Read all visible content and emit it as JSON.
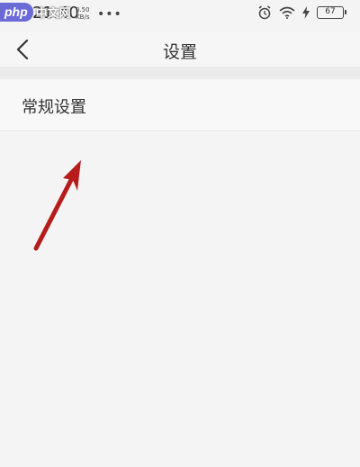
{
  "status_bar": {
    "time": "21:40",
    "net_speed_value": "0.50",
    "net_speed_unit": "KB/s",
    "dots": "•••",
    "battery_level": "67"
  },
  "watermark": {
    "brand": "php",
    "site": "中文网"
  },
  "nav": {
    "title": "设置"
  },
  "settings": {
    "items": [
      {
        "label": "常规设置"
      }
    ]
  },
  "colors": {
    "background": "#f4f4f4",
    "arrow": "#b71c1c",
    "watermark": "#6b6bd8"
  }
}
